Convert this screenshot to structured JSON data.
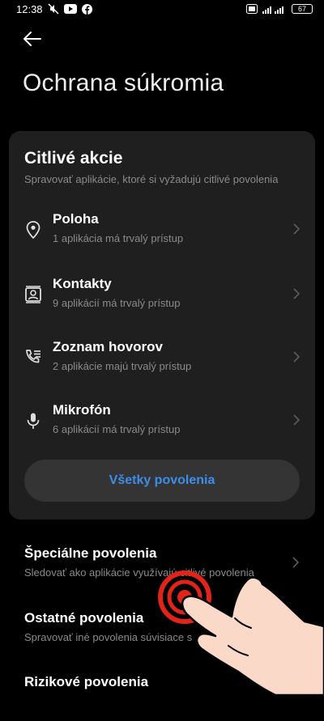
{
  "status_bar": {
    "time": "12:38",
    "battery": "67",
    "icons": [
      "mute-icon",
      "youtube-icon",
      "facebook-icon",
      "vpn-icon",
      "signal-icon",
      "battery-icon"
    ]
  },
  "header": {
    "back_icon": "arrow-left-icon",
    "title": "Ochrana súkromia"
  },
  "sensitive_card": {
    "title": "Citlivé akcie",
    "subtitle": "Spravovať aplikácie, ktoré si vyžadujú citlivé povolenia",
    "items": [
      {
        "label": "Poloha",
        "sub": "1 aplikácia má trvalý prístup",
        "icon": "location-pin-icon"
      },
      {
        "label": "Kontakty",
        "sub": "9 aplikácií má trvalý prístup",
        "icon": "contacts-icon"
      },
      {
        "label": "Zoznam hovorov",
        "sub": "2 aplikácie majú trvalý prístup",
        "icon": "call-log-icon"
      },
      {
        "label": "Mikrofón",
        "sub": "6 aplikácií má trvalý prístup",
        "icon": "microphone-icon"
      }
    ],
    "all_button": "Všetky povolenia"
  },
  "other_items": [
    {
      "label": "Špeciálne povolenia",
      "sub": "Sledovať ako aplikácie využívajú citlivé povolenia"
    },
    {
      "label": "Ostatné povolenia",
      "sub": "Spravovať iné povolenia súvisiace s"
    },
    {
      "label": "Rizikové povolenia",
      "sub": ""
    }
  ],
  "colors": {
    "background": "#000000",
    "card": "#1f1f1f",
    "accent_blue": "#3d8ee8",
    "secondary_text": "#8a8a8a",
    "tap_indicator": "#e2231a",
    "hand": "#fbd9c8"
  }
}
